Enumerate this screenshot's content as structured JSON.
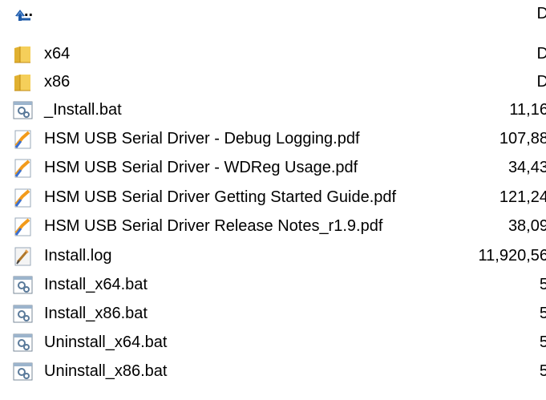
{
  "file_list": {
    "rows": [
      {
        "name": "..",
        "icon": "up-folder-icon",
        "size": "D"
      },
      {
        "name": "x64",
        "icon": "folder-icon",
        "size": "D"
      },
      {
        "name": "x86",
        "icon": "folder-icon",
        "size": "D"
      },
      {
        "name": "_Install.bat",
        "icon": "batch-file-icon",
        "size": "11,16"
      },
      {
        "name": "HSM USB Serial Driver - Debug Logging.pdf",
        "icon": "pdf-file-icon",
        "size": "107,88"
      },
      {
        "name": "HSM USB Serial Driver - WDReg Usage.pdf",
        "icon": "pdf-file-icon",
        "size": "34,43"
      },
      {
        "name": "HSM USB Serial Driver Getting Started Guide.pdf",
        "icon": "pdf-file-icon",
        "size": "121,24"
      },
      {
        "name": "HSM USB Serial Driver Release Notes_r1.9.pdf",
        "icon": "pdf-file-icon",
        "size": "38,09"
      },
      {
        "name": "Install.log",
        "icon": "log-file-icon",
        "size": "11,920,56"
      },
      {
        "name": "Install_x64.bat",
        "icon": "batch-file-icon",
        "size": "5"
      },
      {
        "name": "Install_x86.bat",
        "icon": "batch-file-icon",
        "size": "5"
      },
      {
        "name": "Uninstall_x64.bat",
        "icon": "batch-file-icon",
        "size": "5"
      },
      {
        "name": "Uninstall_x86.bat",
        "icon": "batch-file-icon",
        "size": "5"
      }
    ]
  }
}
